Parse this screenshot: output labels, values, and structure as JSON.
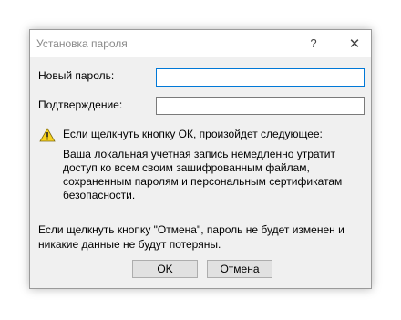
{
  "window": {
    "title": "Установка пароля",
    "help_glyph": "?",
    "close_glyph": "✕"
  },
  "form": {
    "new_password_label": "Новый пароль:",
    "new_password_value": "",
    "confirm_label": "Подтверждение:",
    "confirm_value": ""
  },
  "warning": {
    "icon": "warning-triangle-icon",
    "heading": "Если щелкнуть кнопку ОК, произойдет следующее:",
    "body": "Ваша локальная учетная запись немедленно утратит доступ ко всем своим зашифрованным файлам, сохраненным паролям и персональным сертификатам безопасности."
  },
  "footer": {
    "note": "Если щелкнуть кнопку \"Отмена\", пароль не будет изменен и никакие данные не будут потеряны."
  },
  "buttons": {
    "ok": "OK",
    "cancel": "Отмена"
  },
  "colors": {
    "dialog_bg": "#f0f0f0",
    "titlebar_bg": "#ffffff",
    "focus_border": "#0078d7",
    "warning_fill": "#f8d21f"
  }
}
